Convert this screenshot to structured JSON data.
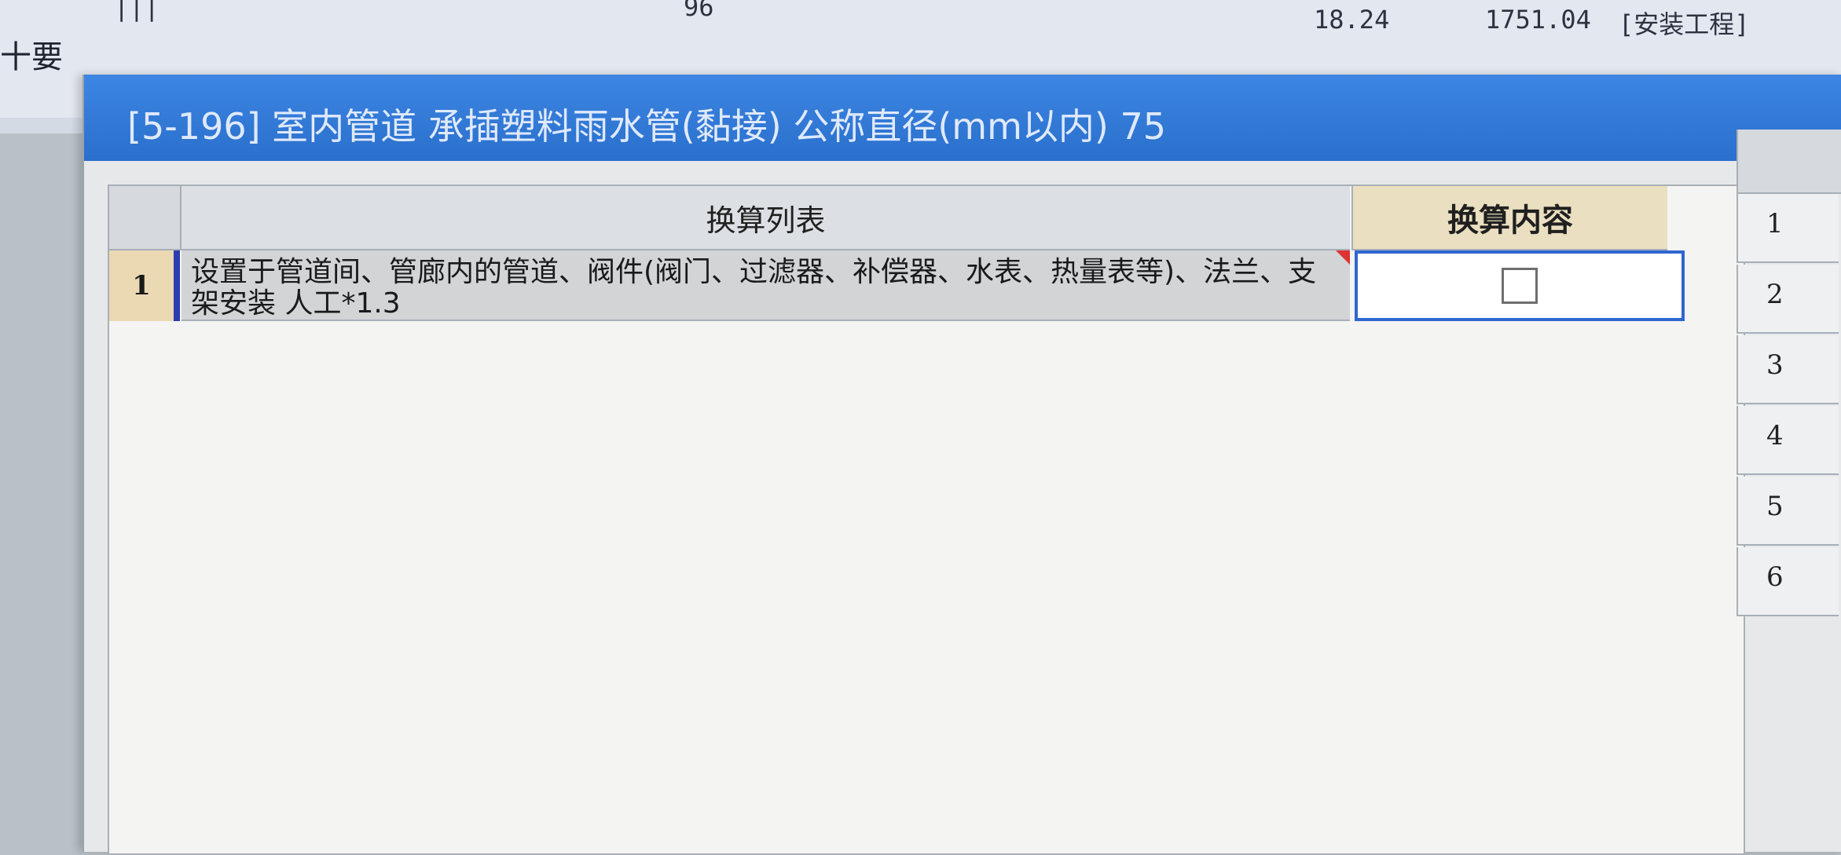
{
  "background_sheet": {
    "left_label": "十要",
    "row_marker": "|||",
    "values": [
      "96",
      "18.24",
      "1751.04",
      "[安装工程]"
    ]
  },
  "dialog": {
    "title": "[5-196] 室内管道 承插塑料雨水管(黏接) 公称直径(mm以内) 75",
    "table": {
      "columns": [
        "换算列表",
        "换算内容"
      ],
      "rows": [
        {
          "index": "1",
          "text": "设置于管道间、管廊内的管道、阀件(阀门、过滤器、补偿器、水表、热量表等)、法兰、支架安装 人工*1.3",
          "checked": false
        }
      ]
    },
    "side_list": {
      "numbers": [
        "1",
        "2",
        "3",
        "4",
        "5",
        "6"
      ]
    }
  }
}
